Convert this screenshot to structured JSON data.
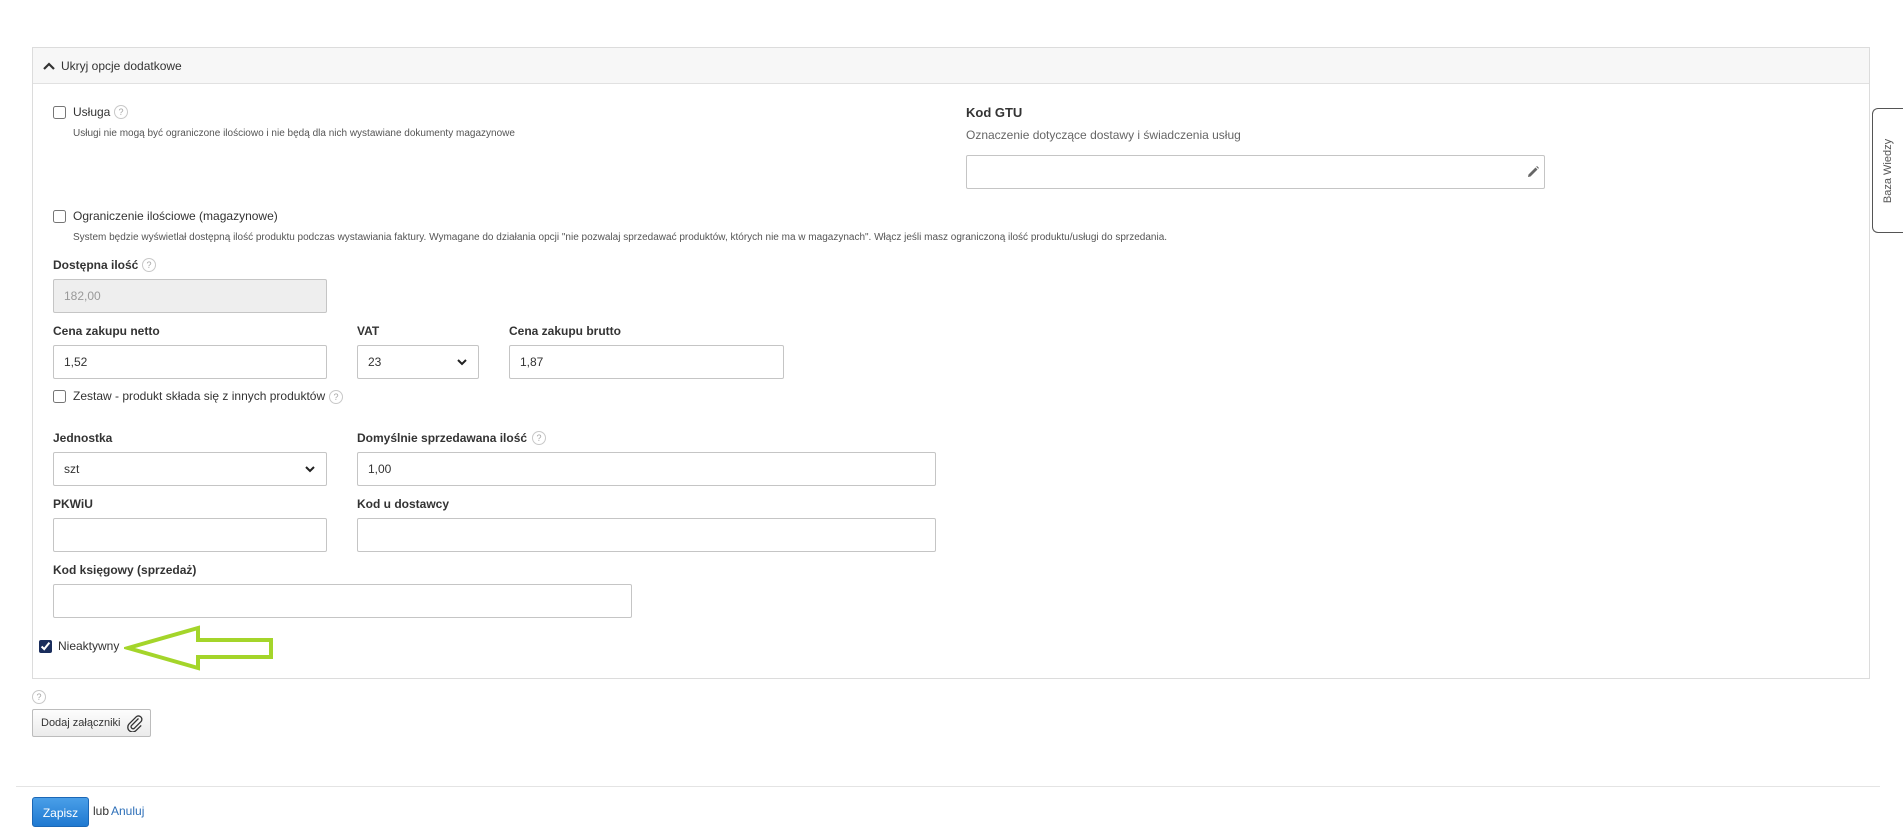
{
  "panel": {
    "title": "Ukryj opcje dodatkowe"
  },
  "service": {
    "label": "Usługa",
    "help": "?",
    "checked": false,
    "note": "Usługi nie mogą być ograniczone ilościowo i nie będą dla nich wystawiane dokumenty magazynowe"
  },
  "gtu": {
    "title": "Kod GTU",
    "subtitle": "Oznaczenie dotyczące dostawy i świadczenia usług",
    "value": ""
  },
  "quantity_limit": {
    "label": "Ograniczenie ilościowe (magazynowe)",
    "checked": false,
    "note": "System będzie wyświetlał dostępną ilość produktu podczas wystawiania faktury. Wymagane do działania opcji \"nie pozwalaj sprzedawać produktów, których nie ma w magazynach\". Włącz jeśli masz ograniczoną ilość produktu/usługi do sprzedania."
  },
  "available": {
    "label": "Dostępna ilość",
    "help": "?",
    "value": "182,00"
  },
  "purchase_net": {
    "label": "Cena zakupu netto",
    "value": "1,52"
  },
  "vat": {
    "label": "VAT",
    "selected": "23"
  },
  "purchase_gross": {
    "label": "Cena zakupu brutto",
    "value": "1,87"
  },
  "bundle": {
    "label": "Zestaw - produkt składa się z innych produktów",
    "help": "?",
    "checked": false
  },
  "unit": {
    "label": "Jednostka",
    "selected": "szt"
  },
  "default_qty": {
    "label": "Domyślnie sprzedawana ilość",
    "help": "?",
    "value": "1,00"
  },
  "pkwiu": {
    "label": "PKWiU",
    "value": ""
  },
  "supplier_code": {
    "label": "Kod u dostawcy",
    "value": ""
  },
  "accounting_code": {
    "label": "Kod księgowy (sprzedaż)",
    "value": ""
  },
  "inactive": {
    "label": "Nieaktywny",
    "checked": true
  },
  "attachments": {
    "help": "?",
    "button_label": "Dodaj załączniki"
  },
  "footer": {
    "save_label": "Zapisz",
    "or_text": "lub",
    "cancel_label": "Anuluj"
  },
  "sidebar_tab": {
    "label": "Baza Wiedzy"
  },
  "colors": {
    "arrow": "#a4d52a",
    "primary_button": "#2a84dc",
    "link": "#2d6fb8"
  },
  "icons": {
    "collapse": "chevron-up-icon",
    "gtu_edit": "pencil-icon",
    "attach": "paperclip-icon",
    "select": "chevron-down-icon",
    "annotation": "arrow-left-icon"
  }
}
